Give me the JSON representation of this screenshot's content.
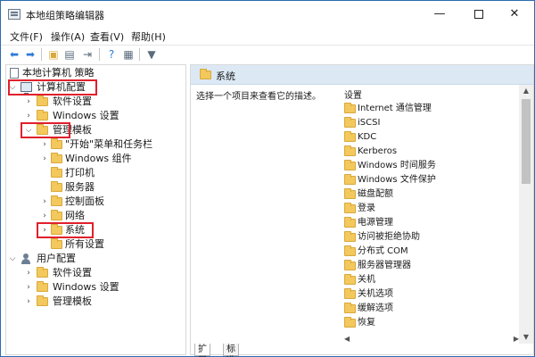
{
  "window": {
    "title": "本地组策略编辑器"
  },
  "menu": [
    "文件(F)",
    "操作(A)",
    "查看(V)",
    "帮助(H)"
  ],
  "tree": {
    "root": "本地计算机 策略",
    "computer_config": "计算机配置",
    "software_settings": "软件设置",
    "windows_settings": "Windows 设置",
    "admin_templates": "管理模板",
    "start_menu": "\"开始\"菜单和任务栏",
    "windows_components": "Windows 组件",
    "printers": "打印机",
    "servers": "服务器",
    "control_panel": "控制面板",
    "network": "网络",
    "system": "系统",
    "all_settings": "所有设置",
    "user_config": "用户配置",
    "user_software_settings": "软件设置",
    "user_windows_settings": "Windows 设置",
    "user_admin_templates": "管理模板"
  },
  "right": {
    "header": "系统",
    "description": "选择一个项目来查看它的描述。",
    "column_header": "设置",
    "items": [
      "Internet 通信管理",
      "iSCSI",
      "KDC",
      "Kerberos",
      "Windows 时间服务",
      "Windows 文件保护",
      "磁盘配额",
      "登录",
      "电源管理",
      "访问被拒绝协助",
      "分布式 COM",
      "服务器管理器",
      "关机",
      "关机选项",
      "缓解选项",
      "恢复"
    ]
  },
  "tabs": {
    "extended": "扩展",
    "standard": "标准"
  },
  "colors": {
    "highlight": "#e0202b",
    "header_bg": "#dce9f5",
    "folder": "#f3c85c"
  }
}
